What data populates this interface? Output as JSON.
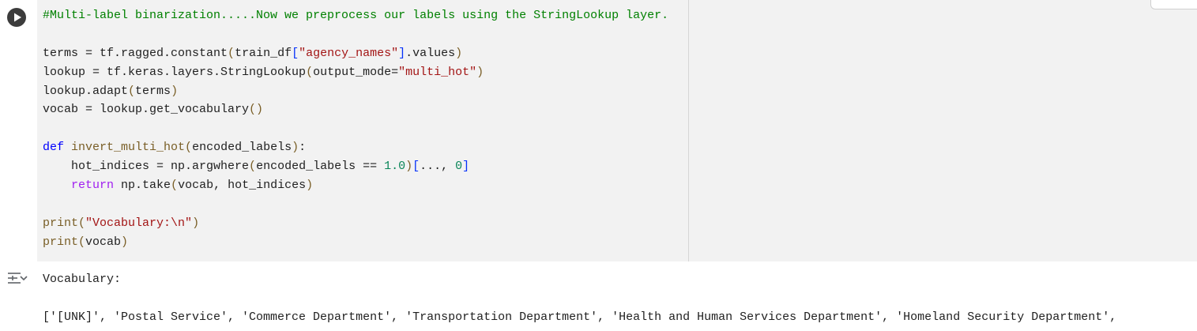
{
  "run_button": {
    "icon": "play-icon"
  },
  "code_lines": [
    [
      {
        "t": "#Multi-label binarization.....Now we preprocess our labels using the StringLookup layer.",
        "c": "cm"
      }
    ],
    [],
    [
      {
        "t": "terms = tf.ragged.constant",
        "c": ""
      },
      {
        "t": "(",
        "c": "p1"
      },
      {
        "t": "train_df",
        "c": ""
      },
      {
        "t": "[",
        "c": "p2"
      },
      {
        "t": "\"agency_names\"",
        "c": "st"
      },
      {
        "t": "]",
        "c": "p2"
      },
      {
        "t": ".values",
        "c": ""
      },
      {
        "t": ")",
        "c": "p1"
      }
    ],
    [
      {
        "t": "lookup = tf.keras.layers.StringLookup",
        "c": ""
      },
      {
        "t": "(",
        "c": "p1"
      },
      {
        "t": "output_mode=",
        "c": ""
      },
      {
        "t": "\"multi_hot\"",
        "c": "st"
      },
      {
        "t": ")",
        "c": "p1"
      }
    ],
    [
      {
        "t": "lookup.adapt",
        "c": ""
      },
      {
        "t": "(",
        "c": "p1"
      },
      {
        "t": "terms",
        "c": ""
      },
      {
        "t": ")",
        "c": "p1"
      }
    ],
    [
      {
        "t": "vocab = lookup.get_vocabulary",
        "c": ""
      },
      {
        "t": "()",
        "c": "p1"
      }
    ],
    [],
    [
      {
        "t": "def ",
        "c": "kwb"
      },
      {
        "t": "invert_multi_hot",
        "c": "fn"
      },
      {
        "t": "(",
        "c": "p1"
      },
      {
        "t": "encoded_labels",
        "c": ""
      },
      {
        "t": ")",
        "c": "p1"
      },
      {
        "t": ":",
        "c": ""
      }
    ],
    [
      {
        "t": "    hot_indices = np.argwhere",
        "c": ""
      },
      {
        "t": "(",
        "c": "p1"
      },
      {
        "t": "encoded_labels == ",
        "c": ""
      },
      {
        "t": "1.0",
        "c": "nu"
      },
      {
        "t": ")",
        "c": "p1"
      },
      {
        "t": "[",
        "c": "p2"
      },
      {
        "t": "..., ",
        "c": ""
      },
      {
        "t": "0",
        "c": "nu"
      },
      {
        "t": "]",
        "c": "p2"
      }
    ],
    [
      {
        "t": "    ",
        "c": ""
      },
      {
        "t": "return",
        "c": "kw"
      },
      {
        "t": " np.take",
        "c": ""
      },
      {
        "t": "(",
        "c": "p1"
      },
      {
        "t": "vocab, hot_indices",
        "c": ""
      },
      {
        "t": ")",
        "c": "p1"
      }
    ],
    [],
    [
      {
        "t": "print",
        "c": "fn"
      },
      {
        "t": "(",
        "c": "p1"
      },
      {
        "t": "\"Vocabulary:\\n\"",
        "c": "st"
      },
      {
        "t": ")",
        "c": "p1"
      }
    ],
    [
      {
        "t": "print",
        "c": "fn"
      },
      {
        "t": "(",
        "c": "p1"
      },
      {
        "t": "vocab",
        "c": ""
      },
      {
        "t": ")",
        "c": "p1"
      }
    ]
  ],
  "output": {
    "toggle_icon": "output-toggle-icon",
    "lines": [
      "Vocabulary:",
      "",
      "['[UNK]', 'Postal Service', 'Commerce Department', 'Transportation Department', 'Health and Human Services Department', 'Homeland Security Department',"
    ]
  },
  "colors": {
    "code_background": "#f2f2f2",
    "comment": "#008000",
    "string": "#a31515",
    "keyword": "#a020f0",
    "number": "#098658"
  }
}
